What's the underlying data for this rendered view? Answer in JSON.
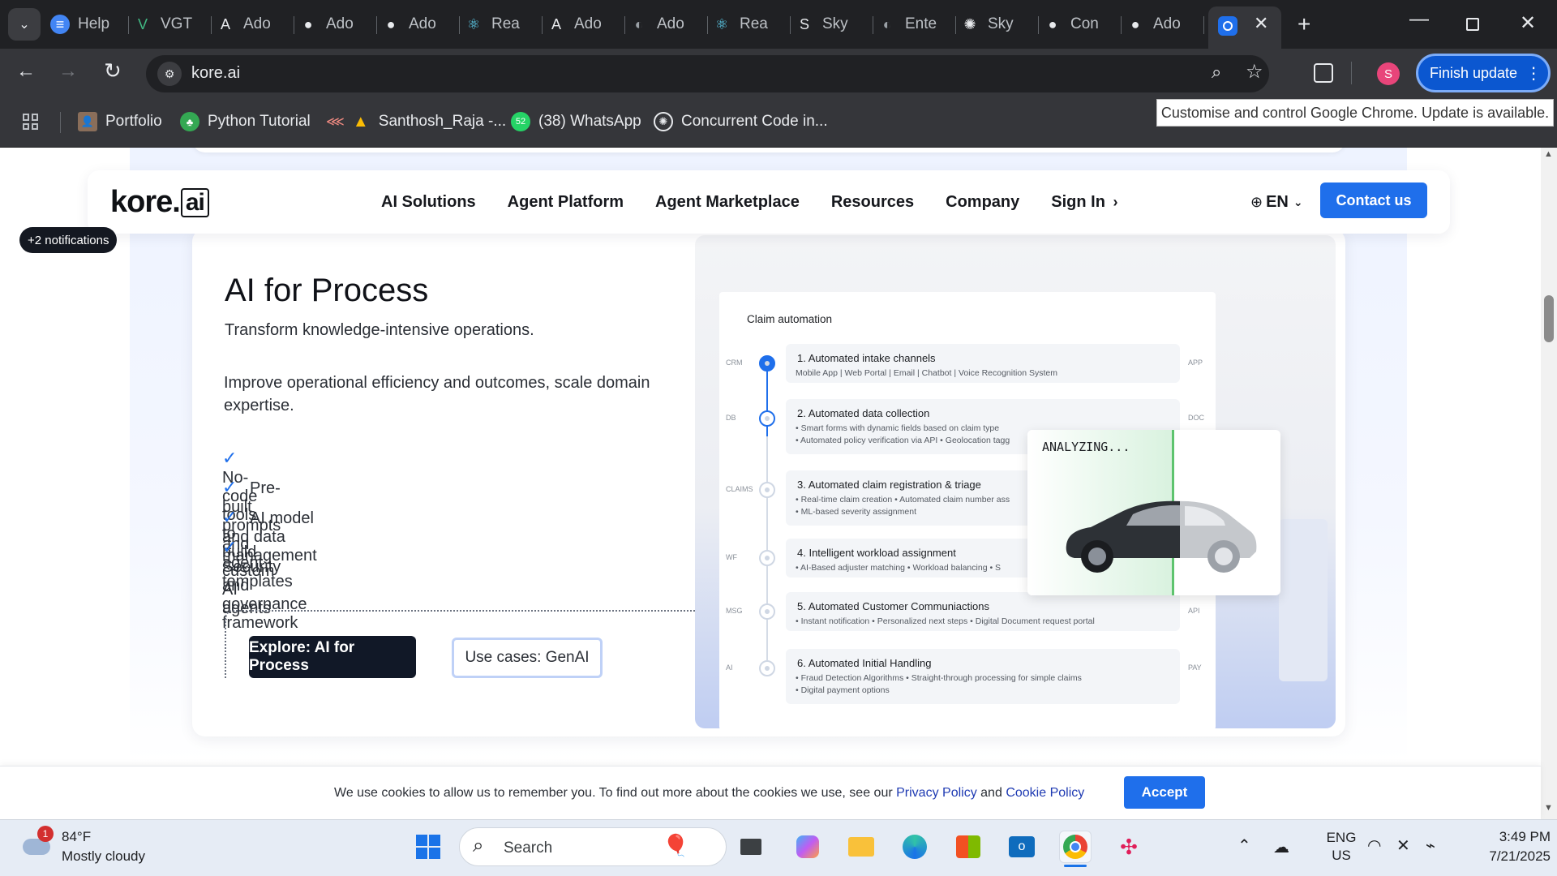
{
  "browser": {
    "tabs": [
      {
        "label": "Help",
        "icon": "docs-icon",
        "color": "#4285f4"
      },
      {
        "label": "VGT",
        "icon": "vue-icon",
        "color": "#41b883"
      },
      {
        "label": "Ado",
        "icon": "adobe-icon",
        "color": "#e8eaed"
      },
      {
        "label": "Ado",
        "icon": "github-icon",
        "color": "#e8eaed"
      },
      {
        "label": "Ado",
        "icon": "github-icon",
        "color": "#e8eaed"
      },
      {
        "label": "Rea",
        "icon": "react-icon",
        "color": "#61dafb"
      },
      {
        "label": "Ado",
        "icon": "adobe-icon",
        "color": "#e8eaed"
      },
      {
        "label": "Ado",
        "icon": "globe-icon",
        "color": "#9aa0a6"
      },
      {
        "label": "Rea",
        "icon": "react-icon",
        "color": "#61dafb"
      },
      {
        "label": "Sky",
        "icon": "skyward-icon",
        "color": "#e8eaed"
      },
      {
        "label": "Ente",
        "icon": "globe-icon",
        "color": "#9aa0a6"
      },
      {
        "label": "Sky",
        "icon": "openai-icon",
        "color": "#e8eaed"
      },
      {
        "label": "Con",
        "icon": "github-icon",
        "color": "#e8eaed"
      },
      {
        "label": "Ado",
        "icon": "github-icon",
        "color": "#e8eaed"
      }
    ],
    "active_tab_icon": "kore-icon",
    "url": "kore.ai",
    "profile_initial": "S",
    "finish_update": "Finish update",
    "tooltip": "Customise and control Google Chrome. Update is available.",
    "bookmarks": [
      {
        "label": "Portfolio",
        "icon": "avatar-icon"
      },
      {
        "label": "Python Tutorial",
        "icon": "python-icon"
      },
      {
        "label": "Santhosh_Raja -...",
        "icon": "warning-icon"
      },
      {
        "label": "(38) WhatsApp",
        "icon": "whatsapp-icon"
      },
      {
        "label": "Concurrent Code in...",
        "icon": "openai-icon"
      }
    ],
    "whatsapp_count": "52"
  },
  "site": {
    "logo_main": "kore.",
    "logo_ai": "ai",
    "nav": [
      "AI Solutions",
      "Agent Platform",
      "Agent Marketplace",
      "Resources",
      "Company"
    ],
    "sign_in": "Sign In",
    "lang": "EN",
    "contact": "Contact us",
    "notifications": "+2 notifications"
  },
  "section": {
    "title": "AI for Process",
    "subtitle": "Transform knowledge-intensive operations.",
    "description": "Improve operational efficiency and outcomes, scale domain expertise.",
    "features": [
      "No-code tools to build custom AI agents",
      "Pre-built prompts and agent templates",
      "AI model and data management",
      "Security and governance framework"
    ],
    "primary_button": "Explore: AI for Process",
    "secondary_button": "Use cases: GenAI"
  },
  "claim": {
    "title": "Claim automation",
    "steps": [
      {
        "left": "CRM",
        "right": "APP",
        "title": "1. Automated intake channels",
        "lines": [
          "Mobile App | Web Portal | Email | Chatbot | Voice Recognition System"
        ]
      },
      {
        "left": "DB",
        "right": "DOC",
        "title": "2. Automated data collection",
        "lines": [
          "•  Smart forms with dynamic fields based on claim type",
          "•  Automated policy verification via API     •  Geolocation tagg"
        ]
      },
      {
        "left": "CLAIMS",
        "right": "",
        "title": "3. Automated claim registration & triage",
        "lines": [
          "•  Real-time claim creation     •  Automated claim number ass",
          "•  ML-based severity assignment"
        ]
      },
      {
        "left": "WF",
        "right": "",
        "title": "4. Intelligent workload assignment",
        "lines": [
          "•  AI-Based adjuster matching     •  Workload balancing     •  S"
        ]
      },
      {
        "left": "MSG",
        "right": "API",
        "title": "5. Automated Customer Communiactions",
        "lines": [
          "•  Instant notification     •  Personalized next steps     •  Digital Document request portal"
        ]
      },
      {
        "left": "AI",
        "right": "PAY",
        "title": "6. Automated Initial Handling",
        "lines": [
          "•  Fraud Detection Algorithms     •  Straight-through processing for simple claims",
          "•  Digital payment options"
        ]
      }
    ],
    "analyzing": "ANALYZING..."
  },
  "cookie": {
    "text": "We use cookies to allow us to remember you. To find out more about the cookies we use, see our",
    "privacy": "Privacy Policy",
    "and": "and",
    "cookie_policy": "Cookie Policy",
    "accept": "Accept"
  },
  "taskbar": {
    "weather_temp": "84°F",
    "weather_desc": "Mostly cloudy",
    "weather_badge": "1",
    "search": "Search",
    "lang1": "ENG",
    "lang2": "US",
    "time": "3:49 PM",
    "date": "7/21/2025"
  },
  "colors": {
    "accent": "#1f6feb",
    "dark_button": "#111827",
    "chrome_dark": "#202124"
  }
}
